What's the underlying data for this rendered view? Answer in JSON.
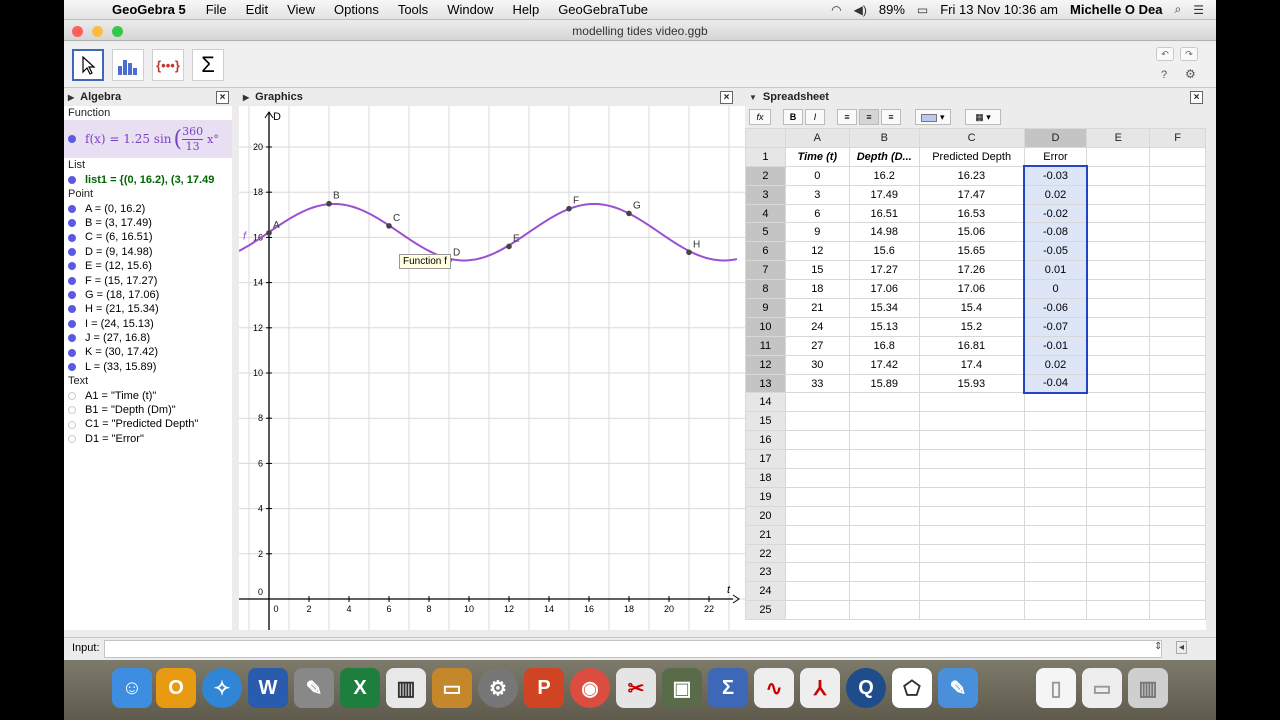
{
  "menubar": {
    "app": "GeoGebra 5",
    "items": [
      "File",
      "Edit",
      "View",
      "Options",
      "Tools",
      "Window",
      "Help",
      "GeoGebraTube"
    ],
    "battery": "89%",
    "clock": "Fri 13 Nov  10:36 am",
    "user": "Michelle O Dea"
  },
  "window": {
    "title": "modelling tides video.ggb"
  },
  "panels": {
    "algebra": "Algebra",
    "graphics": "Graphics",
    "spreadsheet": "Spreadsheet"
  },
  "algebra": {
    "sections": {
      "function": "Function",
      "list": "List",
      "point": "Point",
      "text": "Text"
    },
    "function_text": "f(x) = 1.25 sin",
    "function_frac_num": "360",
    "function_frac_den": "13",
    "function_tail": "x°",
    "list_text": "list1 = {(0, 16.2), (3, 17.49",
    "points": [
      "A = (0, 16.2)",
      "B = (3, 17.49)",
      "C = (6, 16.51)",
      "D = (9, 14.98)",
      "E = (12, 15.6)",
      "F = (15, 17.27)",
      "G = (18, 17.06)",
      "H = (21, 15.34)",
      "I = (24, 15.13)",
      "J = (27, 16.8)",
      "K = (30, 17.42)",
      "L = (33, 15.89)"
    ],
    "texts": [
      "A1 = \"Time (t)\"",
      "B1 = \"Depth (Dm)\"",
      "C1 = \"Predicted Depth\"",
      "D1 = \"Error\""
    ]
  },
  "graphics": {
    "x_axis_label": "t",
    "y_axis_label": "D",
    "x_ticks": [
      "0",
      "2",
      "4",
      "6",
      "8",
      "10",
      "12",
      "14",
      "16",
      "18",
      "20",
      "22"
    ],
    "y_ticks": [
      "2",
      "4",
      "6",
      "8",
      "10",
      "12",
      "14",
      "16",
      "18",
      "20"
    ],
    "origin_label": "0",
    "curve_label": "f",
    "tooltip": "Function f",
    "points": [
      {
        "name": "A",
        "t": 0,
        "d": 16.2
      },
      {
        "name": "B",
        "t": 3,
        "d": 17.49
      },
      {
        "name": "C",
        "t": 6,
        "d": 16.51
      },
      {
        "name": "D",
        "t": 9,
        "d": 14.98
      },
      {
        "name": "E",
        "t": 12,
        "d": 15.6
      },
      {
        "name": "F",
        "t": 15,
        "d": 17.27
      },
      {
        "name": "G",
        "t": 18,
        "d": 17.06
      },
      {
        "name": "H",
        "t": 21,
        "d": 15.34
      }
    ],
    "curve_color": "#9a4fd0"
  },
  "spreadsheet": {
    "columns": [
      "A",
      "B",
      "C",
      "D",
      "E",
      "F"
    ],
    "headers": [
      "Time (t)",
      "Depth (D...",
      "Predicted Depth",
      "Error"
    ],
    "rows": [
      [
        "0",
        "16.2",
        "16.23",
        "-0.03"
      ],
      [
        "3",
        "17.49",
        "17.47",
        "0.02"
      ],
      [
        "6",
        "16.51",
        "16.53",
        "-0.02"
      ],
      [
        "9",
        "14.98",
        "15.06",
        "-0.08"
      ],
      [
        "12",
        "15.6",
        "15.65",
        "-0.05"
      ],
      [
        "15",
        "17.27",
        "17.26",
        "0.01"
      ],
      [
        "18",
        "17.06",
        "17.06",
        "0"
      ],
      [
        "21",
        "15.34",
        "15.4",
        "-0.06"
      ],
      [
        "24",
        "15.13",
        "15.2",
        "-0.07"
      ],
      [
        "27",
        "16.8",
        "16.81",
        "-0.01"
      ],
      [
        "30",
        "17.42",
        "17.4",
        "0.02"
      ],
      [
        "33",
        "15.89",
        "15.93",
        "-0.04"
      ]
    ],
    "row_numbers": [
      "1",
      "2",
      "3",
      "4",
      "5",
      "6",
      "7",
      "8",
      "9",
      "10",
      "11",
      "12",
      "13",
      "14",
      "15",
      "16",
      "17",
      "18",
      "19",
      "20",
      "21",
      "22",
      "23",
      "24",
      "25"
    ]
  },
  "input": {
    "label": "Input:"
  }
}
